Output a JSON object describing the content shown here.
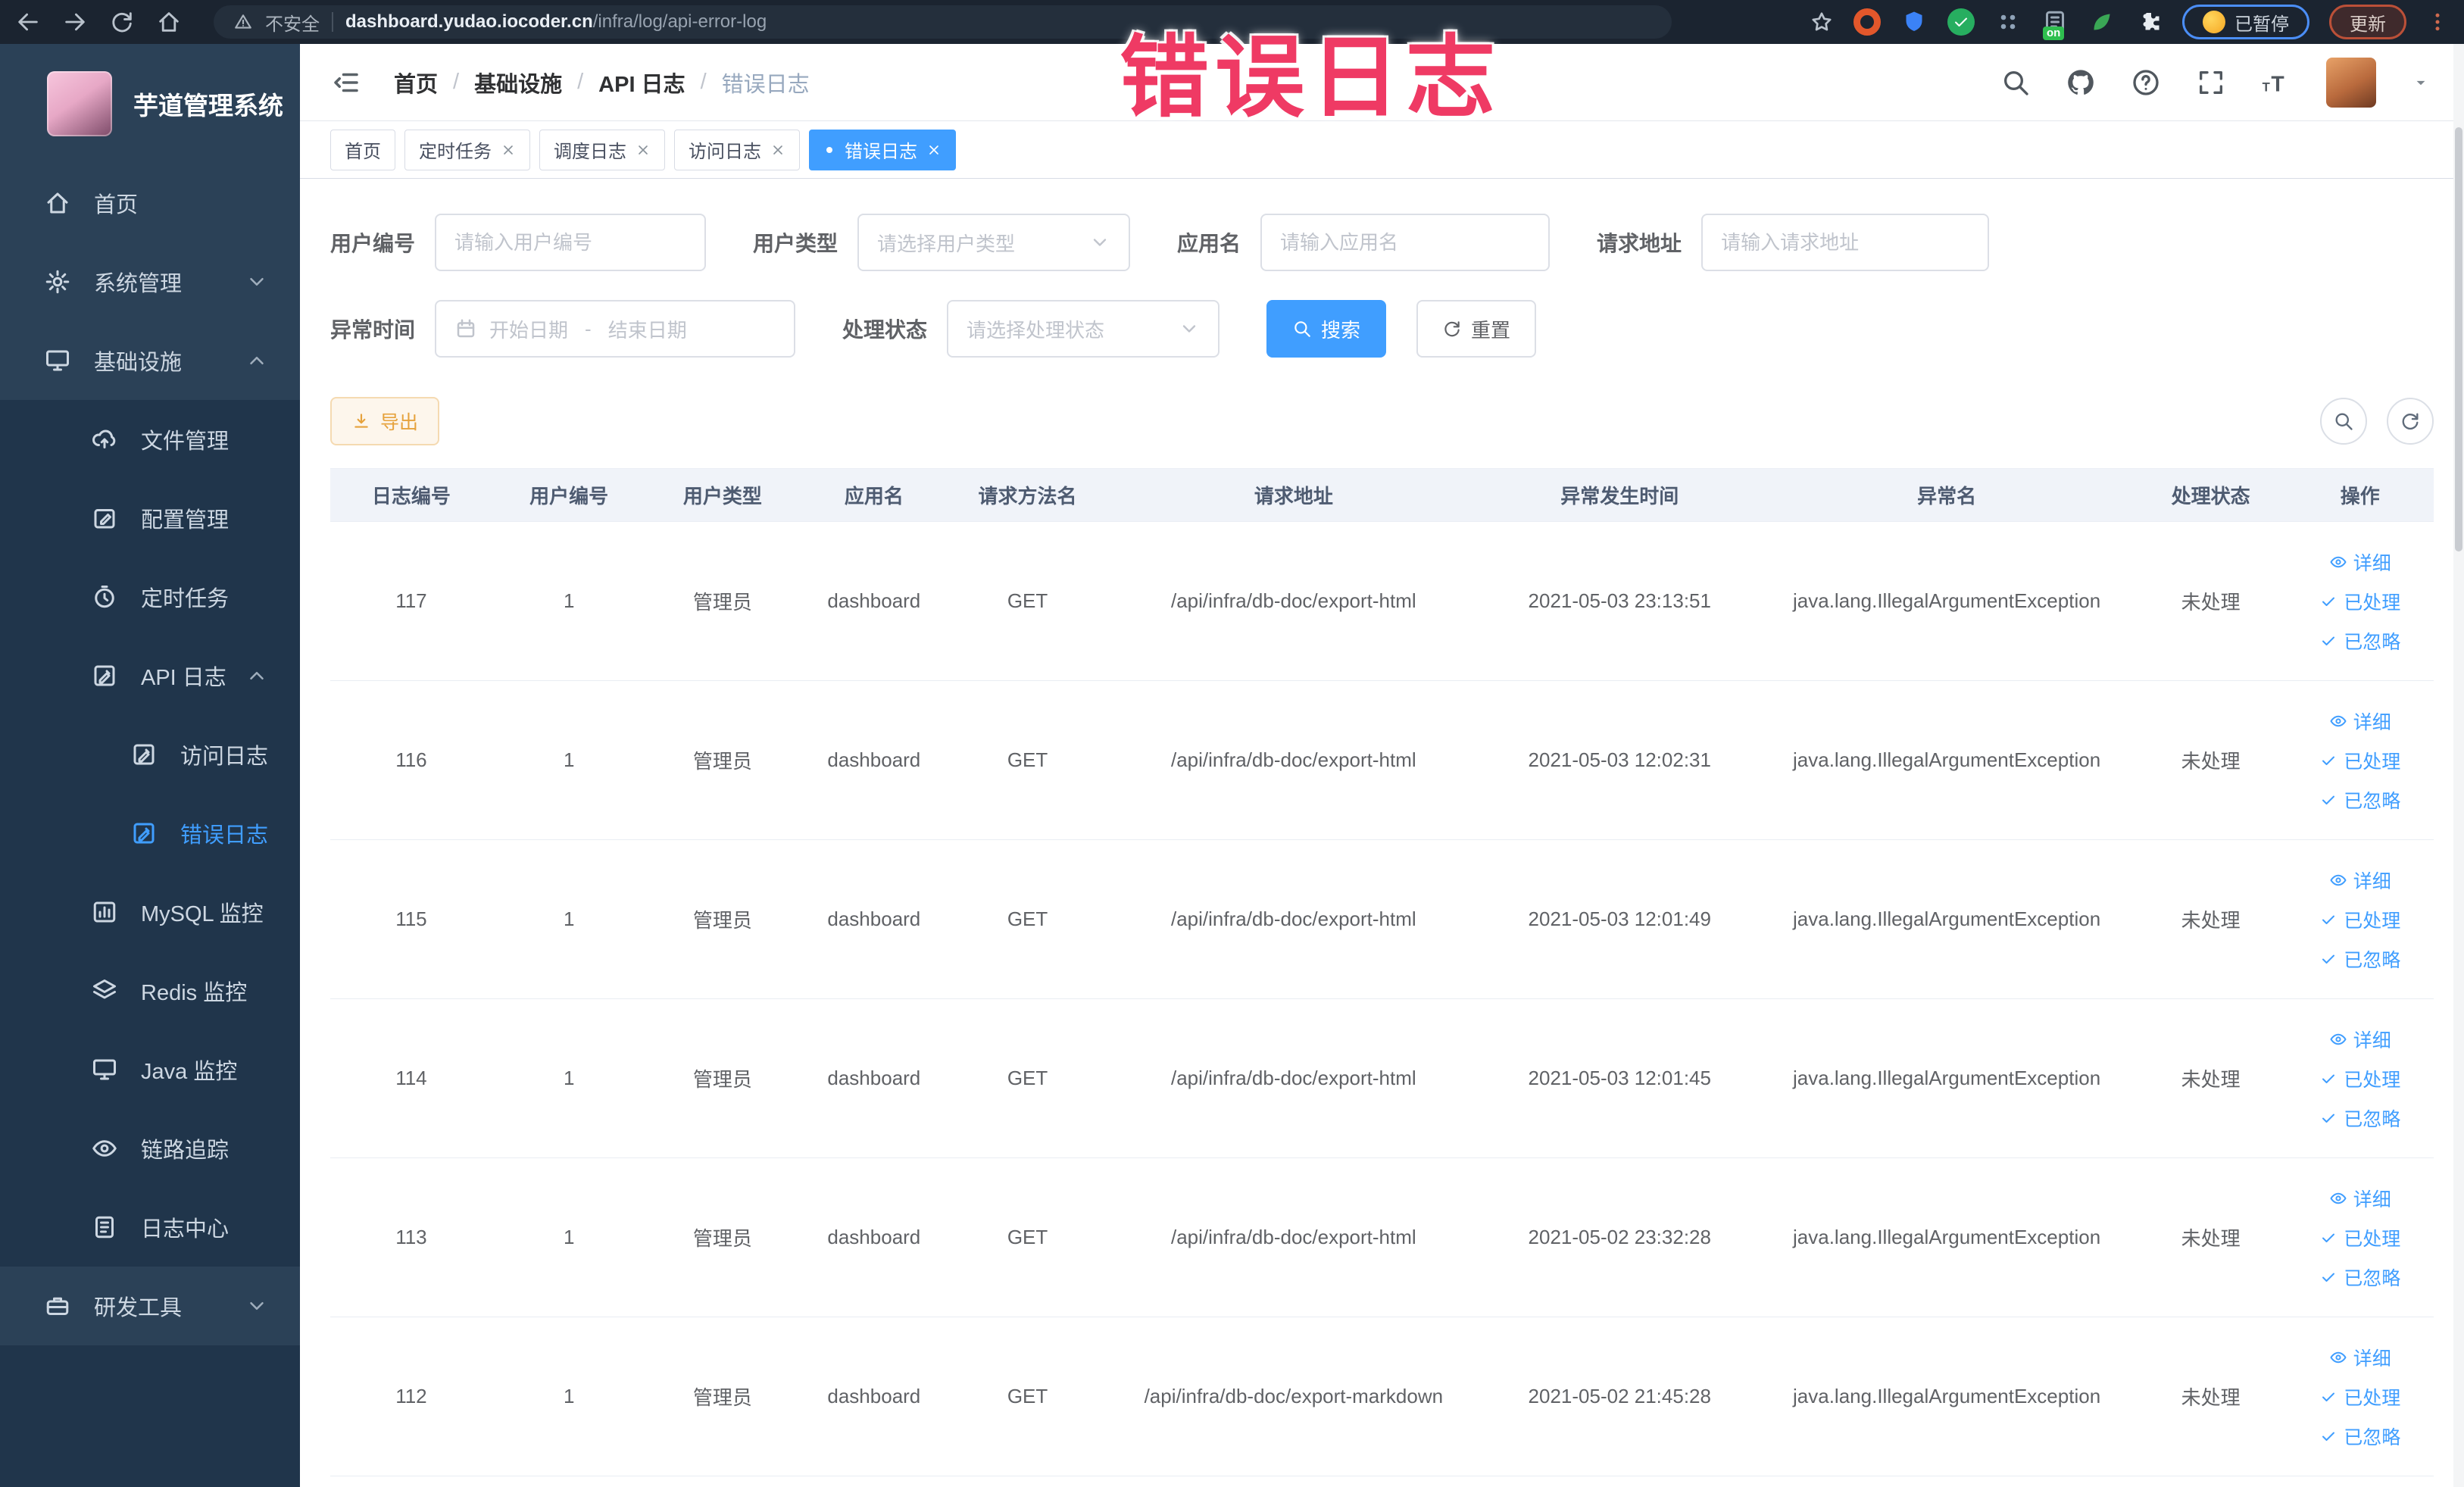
{
  "browser": {
    "security_label": "不安全",
    "url_host": "dashboard.yudao.iocoder.cn",
    "url_path": "/infra/log/api-error-log",
    "paused_label": "已暂停",
    "update_label": "更新"
  },
  "annotation": {
    "text": "错误日志"
  },
  "sidebar": {
    "logo_title": "芋道管理系统",
    "menu": [
      {
        "key": "home",
        "label": "首页",
        "icon": "home",
        "level": 0
      },
      {
        "key": "system-mgmt",
        "label": "系统管理",
        "icon": "gear",
        "level": 0,
        "chevron": "down"
      },
      {
        "key": "infrastructure",
        "label": "基础设施",
        "icon": "monitor",
        "level": 0,
        "chevron": "up"
      },
      {
        "key": "file-mgmt",
        "label": "文件管理",
        "icon": "cloud-upload",
        "level": 1,
        "dark": true
      },
      {
        "key": "config-mgmt",
        "label": "配置管理",
        "icon": "edit",
        "level": 1,
        "dark": true
      },
      {
        "key": "scheduled-tasks",
        "label": "定时任务",
        "icon": "timer",
        "level": 1,
        "dark": true
      },
      {
        "key": "api-log",
        "label": "API 日志",
        "icon": "doc-edit",
        "level": 1,
        "dark": true,
        "chevron": "up"
      },
      {
        "key": "access-log",
        "label": "访问日志",
        "icon": "doc-edit",
        "level": 2,
        "dark": true
      },
      {
        "key": "error-log",
        "label": "错误日志",
        "icon": "doc-edit",
        "level": 2,
        "dark": true,
        "active": true
      },
      {
        "key": "mysql-monitor",
        "label": "MySQL 监控",
        "icon": "chart",
        "level": 1,
        "dark": true
      },
      {
        "key": "redis-monitor",
        "label": "Redis 监控",
        "icon": "layers",
        "level": 1,
        "dark": true
      },
      {
        "key": "java-monitor",
        "label": "Java 监控",
        "icon": "monitor",
        "level": 1,
        "dark": true
      },
      {
        "key": "trace",
        "label": "链路追踪",
        "icon": "eye",
        "level": 1,
        "dark": true
      },
      {
        "key": "log-center",
        "label": "日志中心",
        "icon": "doc",
        "level": 1,
        "dark": true
      },
      {
        "key": "dev-tools",
        "label": "研发工具",
        "icon": "toolbox",
        "level": 0,
        "chevron": "down"
      }
    ]
  },
  "header": {
    "breadcrumb": [
      "首页",
      "基础设施",
      "API 日志",
      "错误日志"
    ]
  },
  "tabs": [
    {
      "key": "home",
      "label": "首页",
      "closable": false,
      "active": false
    },
    {
      "key": "scheduled-tasks",
      "label": "定时任务",
      "closable": true,
      "active": false
    },
    {
      "key": "schedule-log",
      "label": "调度日志",
      "closable": true,
      "active": false
    },
    {
      "key": "access-log",
      "label": "访问日志",
      "closable": true,
      "active": false
    },
    {
      "key": "error-log",
      "label": "错误日志",
      "closable": true,
      "active": true
    }
  ],
  "filters": {
    "fields": [
      {
        "label": "用户编号",
        "placeholder": "请输入用户编号"
      },
      {
        "label": "用户类型",
        "placeholder": "请选择用户类型"
      },
      {
        "label": "应用名",
        "placeholder": "请输入应用名"
      },
      {
        "label": "请求地址",
        "placeholder": "请输入请求地址"
      },
      {
        "label": "异常时间",
        "placeholder_start": "开始日期",
        "separator": "-",
        "placeholder_end": "结束日期"
      },
      {
        "label": "处理状态",
        "placeholder": "请选择处理状态"
      }
    ],
    "search_label": "搜索",
    "reset_label": "重置"
  },
  "toolbar": {
    "export_label": "导出"
  },
  "table": {
    "columns": [
      "日志编号",
      "用户编号",
      "用户类型",
      "应用名",
      "请求方法名",
      "请求地址",
      "异常发生时间",
      "异常名",
      "处理状态",
      "操作"
    ],
    "col_widths": [
      7.7,
      7.3,
      7.3,
      7.1,
      7.5,
      17.8,
      13.2,
      17.9,
      7.2,
      7.0
    ],
    "row_actions": [
      {
        "key": "detail",
        "label": "详细",
        "icon": "eye"
      },
      {
        "key": "processed",
        "label": "已处理",
        "icon": "check"
      },
      {
        "key": "ignored",
        "label": "已忽略",
        "icon": "check"
      }
    ],
    "rows": [
      {
        "log_id": "117",
        "user_id": "1",
        "user_type": "管理员",
        "app": "dashboard",
        "method": "GET",
        "url": "/api/infra/db-doc/export-html",
        "time": "2021-05-03 23:13:51",
        "exception": "java.lang.IllegalArgumentException",
        "status": "未处理"
      },
      {
        "log_id": "116",
        "user_id": "1",
        "user_type": "管理员",
        "app": "dashboard",
        "method": "GET",
        "url": "/api/infra/db-doc/export-html",
        "time": "2021-05-03 12:02:31",
        "exception": "java.lang.IllegalArgumentException",
        "status": "未处理"
      },
      {
        "log_id": "115",
        "user_id": "1",
        "user_type": "管理员",
        "app": "dashboard",
        "method": "GET",
        "url": "/api/infra/db-doc/export-html",
        "time": "2021-05-03 12:01:49",
        "exception": "java.lang.IllegalArgumentException",
        "status": "未处理"
      },
      {
        "log_id": "114",
        "user_id": "1",
        "user_type": "管理员",
        "app": "dashboard",
        "method": "GET",
        "url": "/api/infra/db-doc/export-html",
        "time": "2021-05-03 12:01:45",
        "exception": "java.lang.IllegalArgumentException",
        "status": "未处理"
      },
      {
        "log_id": "113",
        "user_id": "1",
        "user_type": "管理员",
        "app": "dashboard",
        "method": "GET",
        "url": "/api/infra/db-doc/export-html",
        "time": "2021-05-02 23:32:28",
        "exception": "java.lang.IllegalArgumentException",
        "status": "未处理"
      },
      {
        "log_id": "112",
        "user_id": "1",
        "user_type": "管理员",
        "app": "dashboard",
        "method": "GET",
        "url": "/api/infra/db-doc/export-markdown",
        "time": "2021-05-02 21:45:28",
        "exception": "java.lang.IllegalArgumentException",
        "status": "未处理"
      }
    ]
  },
  "colors": {
    "primary": "#409eff",
    "warning": "#e6a23c",
    "annotation": "#ef3a64"
  }
}
